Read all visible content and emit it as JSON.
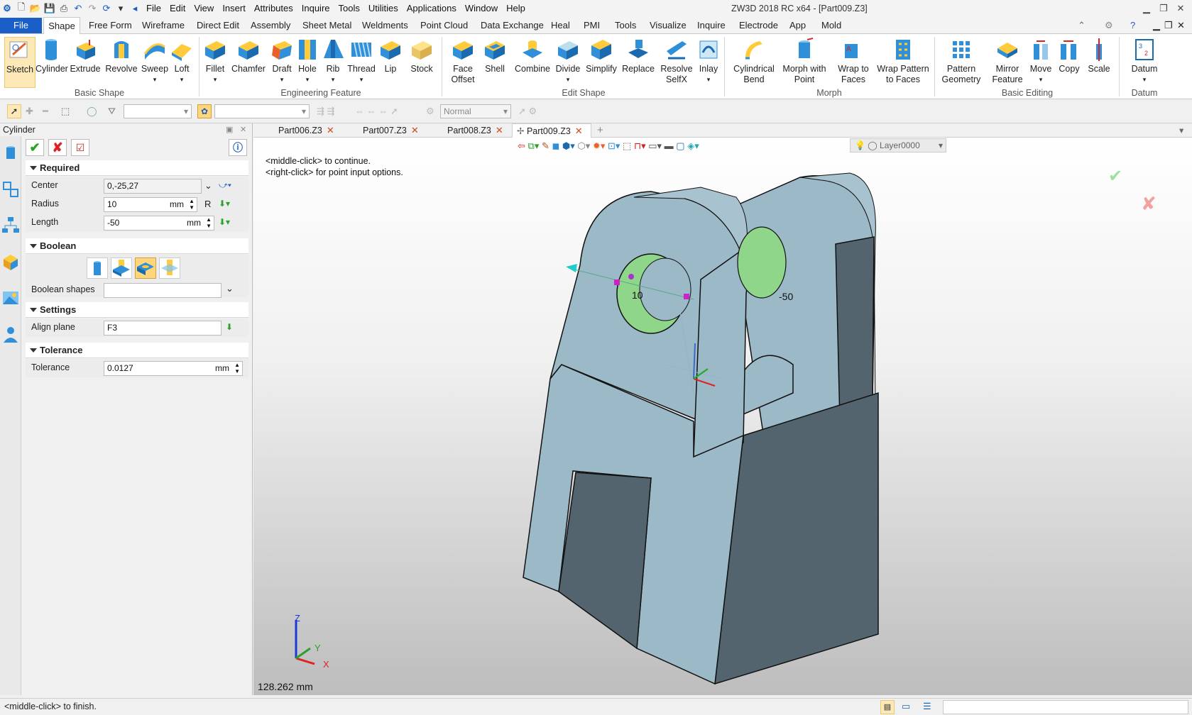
{
  "app": {
    "title": "ZW3D 2018 RC x64 - [Part009.Z3]"
  },
  "menu": [
    "File",
    "Edit",
    "View",
    "Insert",
    "Attributes",
    "Inquire",
    "Tools",
    "Utilities",
    "Applications",
    "Window",
    "Help"
  ],
  "ribbon_tabs": [
    "File",
    "Shape",
    "Free Form",
    "Wireframe",
    "Direct Edit",
    "Assembly",
    "Sheet Metal",
    "Weldments",
    "Point Cloud",
    "Data Exchange",
    "Heal",
    "PMI",
    "Tools",
    "Visualize",
    "Inquire",
    "Electrode",
    "App",
    "Mold"
  ],
  "ribbon": {
    "groups": [
      {
        "label": "Basic Shape",
        "buttons": [
          "Sketch",
          "Cylinder",
          "Extrude",
          "Revolve",
          "Sweep",
          "Loft"
        ]
      },
      {
        "label": "Engineering Feature",
        "buttons": [
          "Fillet",
          "Chamfer",
          "Draft",
          "Hole",
          "Rib",
          "Thread",
          "Lip",
          "Stock"
        ]
      },
      {
        "label": "Edit Shape",
        "buttons": [
          "Face Offset",
          "Shell",
          "Combine",
          "Divide",
          "Simplify",
          "Replace",
          "Resolve SelfX",
          "Inlay"
        ]
      },
      {
        "label": "Morph",
        "buttons": [
          "Cylindrical Bend",
          "Morph with Point",
          "Wrap to Faces",
          "Wrap Pattern to Faces"
        ]
      },
      {
        "label": "Basic Editing",
        "buttons": [
          "Pattern Geometry",
          "Mirror Feature",
          "Move",
          "Copy",
          "Scale"
        ]
      },
      {
        "label": "Datum",
        "buttons": [
          "Datum"
        ]
      }
    ]
  },
  "filterbar": {
    "mode": "Normal"
  },
  "panel": {
    "title": "Cylinder",
    "sections": {
      "required": "Required",
      "boolean": "Boolean",
      "settings": "Settings",
      "tolerance": "Tolerance"
    },
    "center_label": "Center",
    "center_value": "0,-25,27",
    "radius_label": "Radius",
    "radius_value": "10",
    "radius_unit": "mm",
    "radius_suffix": "R",
    "length_label": "Length",
    "length_value": "-50",
    "length_unit": "mm",
    "boolean_shapes_label": "Boolean shapes",
    "align_plane_label": "Align plane",
    "align_plane_value": "F3",
    "tolerance_label": "Tolerance",
    "tolerance_value": "0.0127",
    "tolerance_unit": "mm"
  },
  "doc_tabs": [
    "Part006.Z3",
    "Part007.Z3",
    "Part008.Z3",
    "Part009.Z3"
  ],
  "viewport": {
    "hint_1": "<middle-click> to continue.",
    "hint_2": "<right-click> for point input options.",
    "layer": "Layer0000",
    "dim_radius": "10",
    "dim_length": "-50",
    "scale_readout": "128.262 mm",
    "axis_x": "X",
    "axis_y": "Y",
    "axis_z": "Z"
  },
  "status": {
    "message": "<middle-click> to finish."
  },
  "colors": {
    "accent": "#1a5ec8",
    "part_light": "#9cb9c8",
    "part_dark": "#53646e",
    "hole_green": "#8fd68a"
  }
}
